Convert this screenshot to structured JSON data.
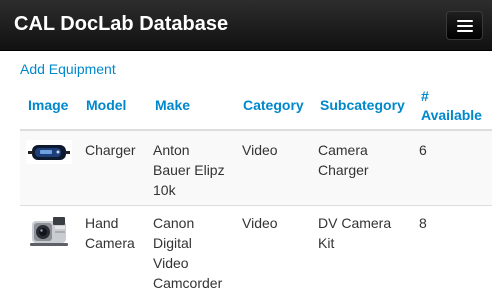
{
  "navbar": {
    "brand": "CAL DocLab Database",
    "menu_icon": "hamburger-menu-icon"
  },
  "actions": {
    "add_equipment": "Add Equipment"
  },
  "table": {
    "headers": {
      "image": "Image",
      "model": "Model",
      "make": "Make",
      "category": "Category",
      "subcategory": "Subcategory",
      "available_line1": "#",
      "available_line2": "Available"
    },
    "rows": [
      {
        "image": "battery-charger-photo",
        "model": "Charger",
        "make": "Anton\nBauer Elipz\n10k",
        "category": "Video",
        "subcategory": "Camera\nCharger",
        "available": "6"
      },
      {
        "image": "handheld-camcorder-photo",
        "model": "Hand\nCamera",
        "make": "Canon\nDigital\nVideo\nCamcorder",
        "category": "Video",
        "subcategory": "DV Camera\nKit",
        "available": "8"
      }
    ]
  },
  "colors": {
    "navbar": "#1b1b1b",
    "link": "#0088cc",
    "text": "#333333",
    "stripe": "#f9f9f9",
    "rule": "#dddddd"
  }
}
